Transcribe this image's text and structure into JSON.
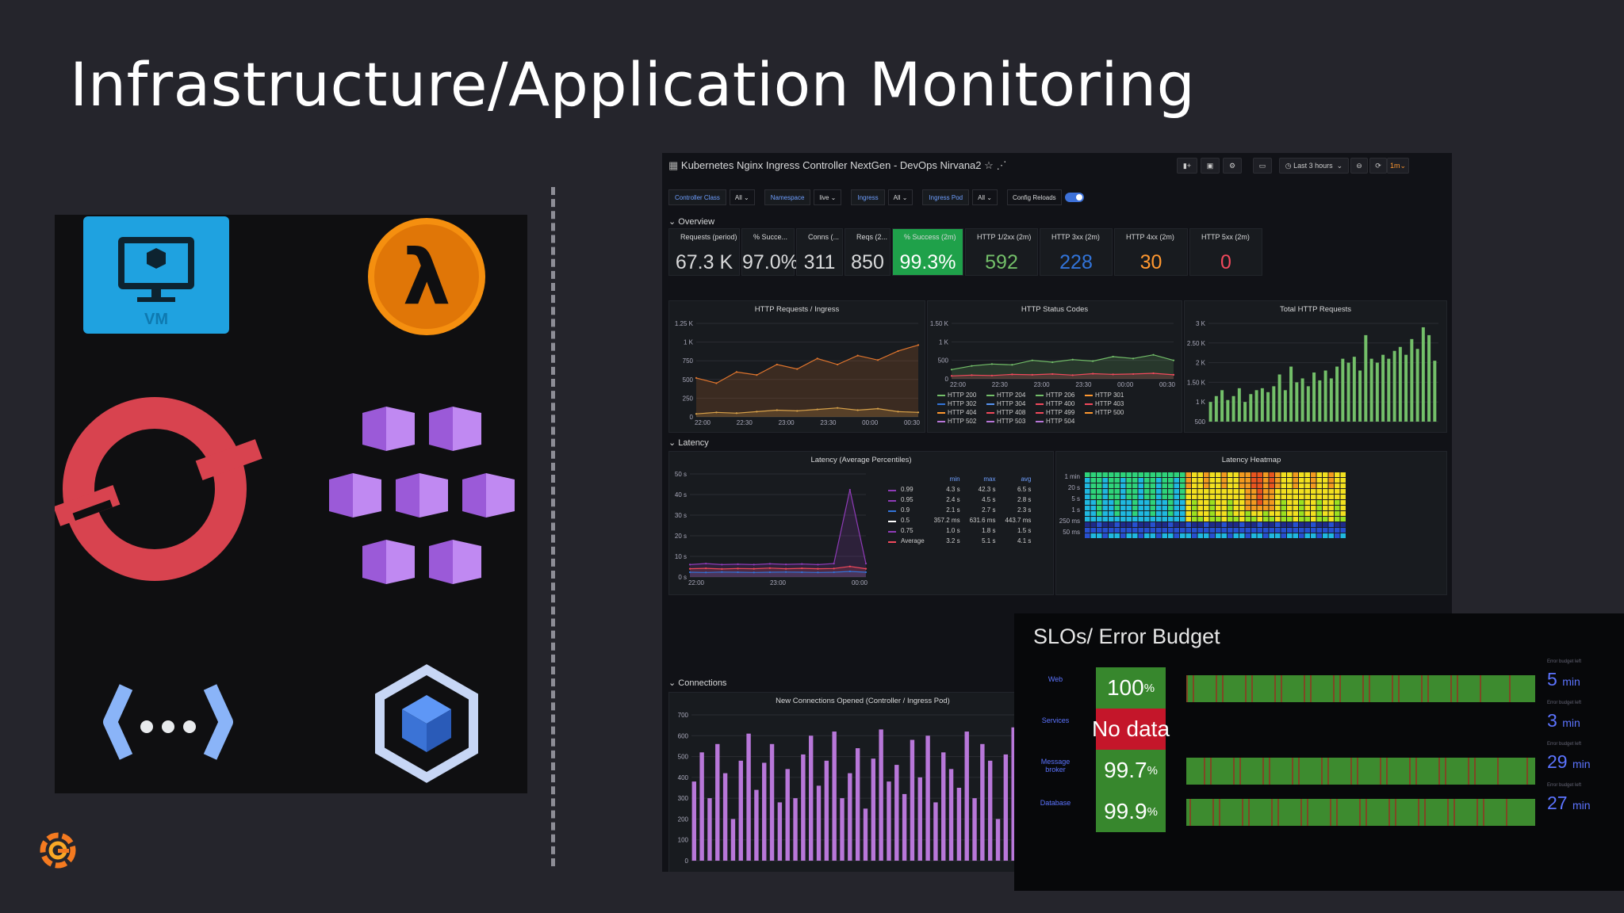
{
  "slide": {
    "title": "Infrastructure/Application Monitoring",
    "logos": [
      "vm-icon",
      "aws-lambda-icon",
      "openshift-icon",
      "azure-kubernetes-icon",
      "cloud-functions-icon",
      "container-cube-icon"
    ],
    "vm_label": "VM"
  },
  "dashboard": {
    "title": "Kubernetes Nginx Ingress Controller NextGen - DevOps Nirvana2",
    "time_range": "Last 3 hours",
    "refresh": "1m",
    "variables": [
      {
        "label": "Controller Class",
        "value": "All"
      },
      {
        "label": "Namespace",
        "value": "live"
      },
      {
        "label": "Ingress",
        "value": "All"
      },
      {
        "label": "Ingress Pod",
        "value": "All"
      }
    ],
    "config_reloads_label": "Config Reloads",
    "rows": {
      "overview": "Overview",
      "latency": "Latency",
      "connections": "Connections"
    },
    "stats": [
      {
        "title": "Requests (period)",
        "value": "67.3 K",
        "bg": "#181b1f",
        "color": "#d8d9da"
      },
      {
        "title": "% Succe...",
        "value": "97.0%",
        "bg": "#181b1f",
        "color": "#d8d9da"
      },
      {
        "title": "Conns (...",
        "value": "311",
        "bg": "#181b1f",
        "color": "#d8d9da"
      },
      {
        "title": "Reqs (2...",
        "value": "850",
        "bg": "#181b1f",
        "color": "#d8d9da"
      },
      {
        "title": "% Success (2m)",
        "value": "99.3%",
        "bg": "#1fa14a",
        "color": "#ffffff"
      },
      {
        "title": "HTTP 1/2xx (2m)",
        "value": "592",
        "bg": "#181b1f",
        "color": "#73bf69"
      },
      {
        "title": "HTTP 3xx (2m)",
        "value": "228",
        "bg": "#181b1f",
        "color": "#3274d9"
      },
      {
        "title": "HTTP 4xx (2m)",
        "value": "30",
        "bg": "#181b1f",
        "color": "#ff9830"
      },
      {
        "title": "HTTP 5xx (2m)",
        "value": "0",
        "bg": "#181b1f",
        "color": "#f2495c"
      }
    ],
    "panels": {
      "http_requests": "HTTP Requests / Ingress",
      "status_codes": "HTTP Status Codes",
      "total_requests": "Total HTTP Requests",
      "latency_avg": "Latency (Average Percentiles)",
      "latency_heatmap": "Latency Heatmap",
      "new_connections": "New Connections Opened (Controller / Ingress Pod)"
    },
    "status_legend": [
      {
        "name": "HTTP 200",
        "color": "#73bf69"
      },
      {
        "name": "HTTP 204",
        "color": "#73bf69"
      },
      {
        "name": "HTTP 206",
        "color": "#73bf69"
      },
      {
        "name": "HTTP 301",
        "color": "#ff9830"
      },
      {
        "name": "HTTP 302",
        "color": "#3274d9"
      },
      {
        "name": "HTTP 304",
        "color": "#5794f2"
      },
      {
        "name": "HTTP 400",
        "color": "#f2495c"
      },
      {
        "name": "HTTP 403",
        "color": "#f2495c"
      },
      {
        "name": "HTTP 404",
        "color": "#ff9830"
      },
      {
        "name": "HTTP 408",
        "color": "#f2495c"
      },
      {
        "name": "HTTP 499",
        "color": "#f2495c"
      },
      {
        "name": "HTTP 500",
        "color": "#ff9830"
      },
      {
        "name": "HTTP 502",
        "color": "#b877d9"
      },
      {
        "name": "HTTP 503",
        "color": "#b877d9"
      },
      {
        "name": "HTTP 504",
        "color": "#b877d9"
      }
    ],
    "latency_table": {
      "headers": [
        "min",
        "max",
        "avg"
      ],
      "rows": [
        {
          "name": "0.99",
          "color": "#8f3bb8",
          "min": "4.3 s",
          "max": "42.3 s",
          "avg": "6.5 s"
        },
        {
          "name": "0.95",
          "color": "#8f3bb8",
          "min": "2.4 s",
          "max": "4.5 s",
          "avg": "2.8 s"
        },
        {
          "name": "0.9",
          "color": "#3274d9",
          "min": "2.1 s",
          "max": "2.7 s",
          "avg": "2.3 s"
        },
        {
          "name": "0.5",
          "color": "#ffffff",
          "min": "357.2 ms",
          "max": "631.6 ms",
          "avg": "443.7 ms"
        },
        {
          "name": "0.75",
          "color": "#8f3bb8",
          "min": "1.0 s",
          "max": "1.8 s",
          "avg": "1.5 s"
        },
        {
          "name": "Average",
          "color": "#f2495c",
          "min": "3.2 s",
          "max": "5.1 s",
          "avg": "4.1 s"
        }
      ]
    },
    "heatmap_yticks": [
      "1 min",
      "20 s",
      "5 s",
      "1 s",
      "250 ms",
      "50 ms"
    ]
  },
  "slo": {
    "title": "SLOs/ Error Budget",
    "budget_label": "Error budget left",
    "rows": [
      {
        "name": "Web",
        "value": "100",
        "unit": "%",
        "badge_bg": "#37872d",
        "budget": "5",
        "budget_unit": "min",
        "has_bar": true
      },
      {
        "name": "Services",
        "value": "No data",
        "unit": "",
        "badge_bg": "#c4162a",
        "budget": "3",
        "budget_unit": "min",
        "has_bar": false
      },
      {
        "name": "Message broker",
        "value": "99.7",
        "unit": "%",
        "badge_bg": "#37872d",
        "budget": "29",
        "budget_unit": "min",
        "has_bar": true
      },
      {
        "name": "Database",
        "value": "99.9",
        "unit": "%",
        "badge_bg": "#37872d",
        "budget": "27",
        "budget_unit": "min",
        "has_bar": true
      }
    ]
  },
  "chart_data": [
    {
      "type": "line",
      "title": "HTTP Requests / Ingress",
      "x": [
        "22:00",
        "22:30",
        "23:00",
        "23:30",
        "00:00",
        "00:30"
      ],
      "ylim": [
        0,
        1250
      ],
      "yticks": [
        "0",
        "250",
        "500",
        "750",
        "1 K",
        "1.25 K"
      ],
      "series": [
        {
          "color": "#e0752d",
          "values": [
            520,
            450,
            600,
            560,
            700,
            640,
            780,
            700,
            820,
            760,
            880,
            960
          ]
        },
        {
          "color": "#d8a24a",
          "values": [
            40,
            60,
            50,
            70,
            90,
            80,
            100,
            120,
            90,
            110,
            70,
            60
          ]
        }
      ]
    },
    {
      "type": "line",
      "title": "HTTP Status Codes",
      "x": [
        "22:00",
        "22:30",
        "23:00",
        "23:30",
        "00:00",
        "00:30"
      ],
      "ylim": [
        0,
        1500
      ],
      "yticks": [
        "0",
        "500",
        "1 K",
        "1.50 K"
      ],
      "series": [
        {
          "color": "#73bf69",
          "values": [
            250,
            350,
            400,
            380,
            500,
            450,
            520,
            480,
            600,
            550,
            650,
            500
          ]
        },
        {
          "color": "#f2495c",
          "values": [
            80,
            100,
            90,
            120,
            110,
            130,
            100,
            140,
            120,
            130,
            150,
            110
          ]
        }
      ]
    },
    {
      "type": "bar",
      "title": "Total HTTP Requests",
      "ylim": [
        500,
        3000
      ],
      "yticks": [
        "500",
        "1 K",
        "1.50 K",
        "2 K",
        "2.50 K",
        "3 K"
      ],
      "values": [
        1000,
        1150,
        1300,
        1050,
        1150,
        1350,
        1000,
        1200,
        1300,
        1350,
        1250,
        1400,
        1700,
        1300,
        1900,
        1500,
        1600,
        1400,
        1750,
        1550,
        1800,
        1600,
        1900,
        2100,
        2000,
        2150,
        1800,
        2700,
        2100,
        2000,
        2200,
        2100,
        2300,
        2400,
        2200,
        2600,
        2350,
        2900,
        2700,
        2050
      ]
    },
    {
      "type": "line",
      "title": "Latency (Average Percentiles)",
      "x": [
        "22:00",
        "23:00",
        "00:00"
      ],
      "ylim": [
        0,
        50
      ],
      "yticks": [
        "0 s",
        "10 s",
        "20 s",
        "30 s",
        "40 s",
        "50 s"
      ],
      "series": [
        {
          "name": "0.99",
          "color": "#8f3bb8",
          "values": [
            6,
            6.5,
            6,
            6.2,
            6,
            6.4,
            6.1,
            6.3,
            6,
            6.5,
            42.3,
            6.5
          ]
        },
        {
          "name": "Average",
          "color": "#f2495c",
          "values": [
            4,
            4.2,
            3.9,
            4.1,
            4,
            4.3,
            4,
            4.2,
            4,
            4.1,
            5.1,
            4
          ]
        },
        {
          "name": "0.9",
          "color": "#3274d9",
          "values": [
            2.3,
            2.2,
            2.4,
            2.3,
            2.2,
            2.3,
            2.4,
            2.3,
            2.2,
            2.3,
            2.7,
            2.3
          ]
        }
      ]
    },
    {
      "type": "bar",
      "title": "New Connections Opened (Controller / Ingress Pod)",
      "ylim": [
        0,
        700
      ],
      "yticks": [
        "0",
        "100",
        "200",
        "300",
        "400",
        "500",
        "600",
        "700"
      ],
      "values": [
        380,
        520,
        300,
        560,
        420,
        200,
        480,
        610,
        340,
        470,
        560,
        280,
        440,
        300,
        510,
        600,
        360,
        480,
        620,
        300,
        420,
        540,
        250,
        490,
        630,
        380,
        460,
        320,
        580,
        400,
        600,
        280,
        520,
        440,
        350,
        620,
        300,
        560,
        480,
        200,
        510,
        640,
        380,
        460,
        300,
        590
      ]
    }
  ]
}
